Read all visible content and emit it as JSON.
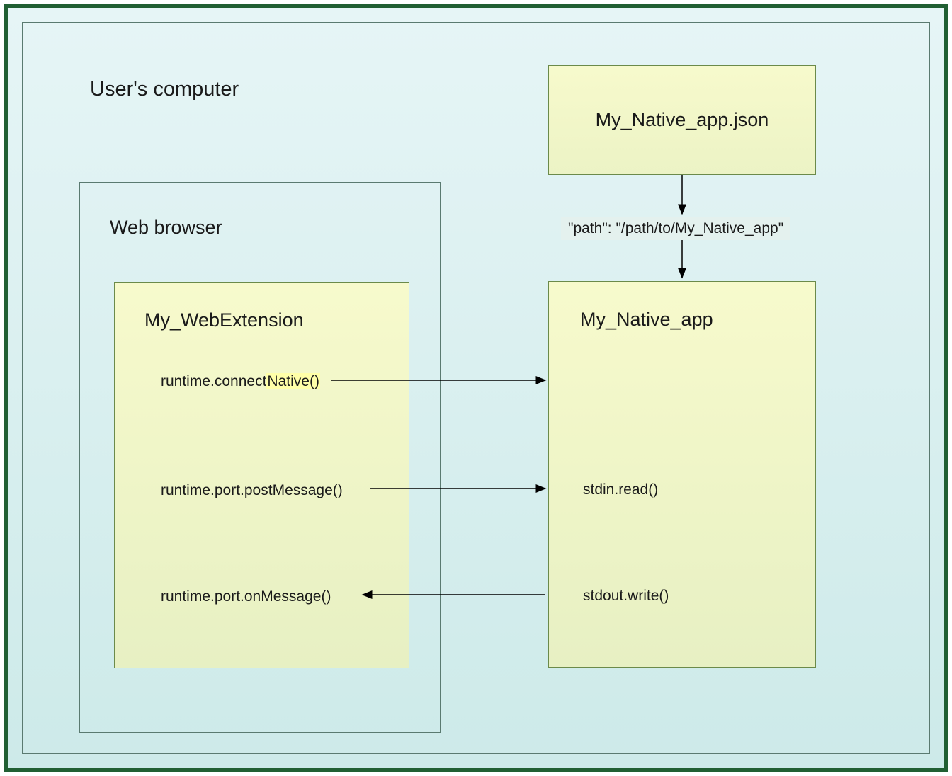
{
  "container": {
    "title": "User's computer"
  },
  "browser": {
    "title": "Web browser",
    "extension": {
      "title": "My_WebExtension",
      "api_connect_prefix": "runtime.connect",
      "api_connect_highlight": "Native()",
      "api_post": "runtime.port.postMessage()",
      "api_on": "runtime.port.onMessage()"
    }
  },
  "native_manifest": {
    "title": "My_Native_app.json",
    "path_entry": "\"path\": \"/path/to/My_Native_app\""
  },
  "native_app": {
    "title": "My_Native_app",
    "stdin": "stdin.read()",
    "stdout": "stdout.write()"
  }
}
